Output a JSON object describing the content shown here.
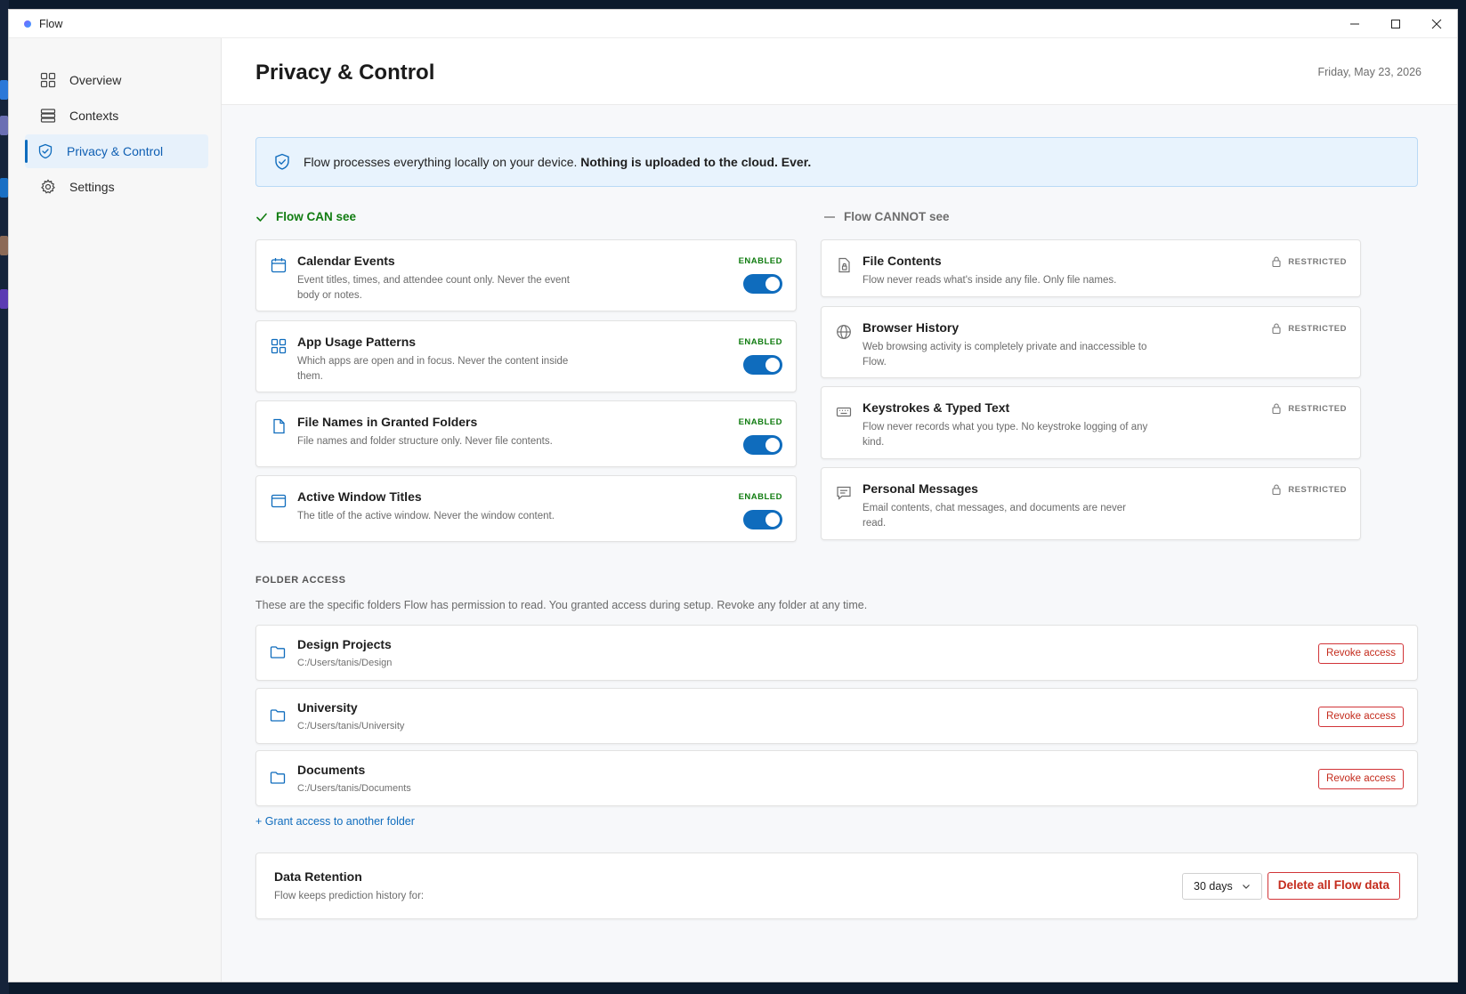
{
  "window": {
    "title": "Flow"
  },
  "sidebar": {
    "items": [
      {
        "label": "Overview",
        "icon": "grid-icon"
      },
      {
        "label": "Contexts",
        "icon": "list-stack-icon"
      },
      {
        "label": "Privacy & Control",
        "icon": "shield-check-icon",
        "active": true
      },
      {
        "label": "Settings",
        "icon": "gear-icon"
      }
    ]
  },
  "header": {
    "title": "Privacy & Control",
    "date": "Friday, May 23, 2026"
  },
  "banner": {
    "text": "Flow processes everything locally on your device.",
    "bold": "Nothing is uploaded to the cloud. Ever."
  },
  "can_see": {
    "heading": "Flow CAN see",
    "items": [
      {
        "title": "Calendar Events",
        "desc": "Event titles, times, and attendee count only. Never the event body or notes.",
        "status": "ENABLED",
        "enabled": true
      },
      {
        "title": "App Usage Patterns",
        "desc": "Which apps are open and in focus. Never the content inside them.",
        "status": "ENABLED",
        "enabled": true
      },
      {
        "title": "File Names in Granted Folders",
        "desc": "File names and folder structure only. Never file contents.",
        "status": "ENABLED",
        "enabled": true
      },
      {
        "title": "Active Window Titles",
        "desc": "The title of the active window. Never the window content.",
        "status": "ENABLED",
        "enabled": true
      }
    ]
  },
  "cannot_see": {
    "heading": "Flow CANNOT see",
    "items": [
      {
        "title": "File Contents",
        "desc": "Flow never reads what's inside any file. Only file names.",
        "status": "RESTRICTED"
      },
      {
        "title": "Browser History",
        "desc": "Web browsing activity is completely private and inaccessible to Flow.",
        "status": "RESTRICTED"
      },
      {
        "title": "Keystrokes & Typed Text",
        "desc": "Flow never records what you type. No keystroke logging of any kind.",
        "status": "RESTRICTED"
      },
      {
        "title": "Personal Messages",
        "desc": "Email contents, chat messages, and documents are never read.",
        "status": "RESTRICTED"
      }
    ]
  },
  "folder_access": {
    "label": "FOLDER ACCESS",
    "desc": "These are the specific folders Flow has permission to read. You granted access during setup. Revoke any folder at any time.",
    "folders": [
      {
        "name": "Design Projects",
        "path": "C:/Users/tanis/Design",
        "action": "Revoke access"
      },
      {
        "name": "University",
        "path": "C:/Users/tanis/University",
        "action": "Revoke access"
      },
      {
        "name": "Documents",
        "path": "C:/Users/tanis/Documents",
        "action": "Revoke access"
      }
    ],
    "grant_link": "+ Grant access to another folder"
  },
  "retention": {
    "title": "Data Retention",
    "desc": "Flow keeps prediction history for:",
    "selected": "30 days",
    "delete_label": "Delete all Flow data"
  },
  "colors": {
    "accent": "#0f6cbd",
    "enabled": "#107c10",
    "danger": "#c42b1c",
    "banner_bg": "#e8f3fd"
  }
}
